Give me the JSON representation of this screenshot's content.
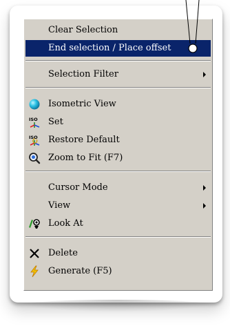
{
  "menu": {
    "items": [
      {
        "label": "Clear Selection"
      },
      {
        "label": "End selection / Place offset"
      },
      {
        "label": "Selection Filter"
      },
      {
        "label": "Isometric View"
      },
      {
        "label": "Set"
      },
      {
        "label": "Restore Default"
      },
      {
        "label": "Zoom to Fit (F7)"
      },
      {
        "label": "Cursor Mode"
      },
      {
        "label": "View"
      },
      {
        "label": "Look At"
      },
      {
        "label": "Delete"
      },
      {
        "label": "Generate (F5)"
      }
    ]
  },
  "icons": {
    "iso_text": "ISO"
  },
  "colors": {
    "menu_bg": "#d4d0c8",
    "highlight": "#0a246a"
  }
}
